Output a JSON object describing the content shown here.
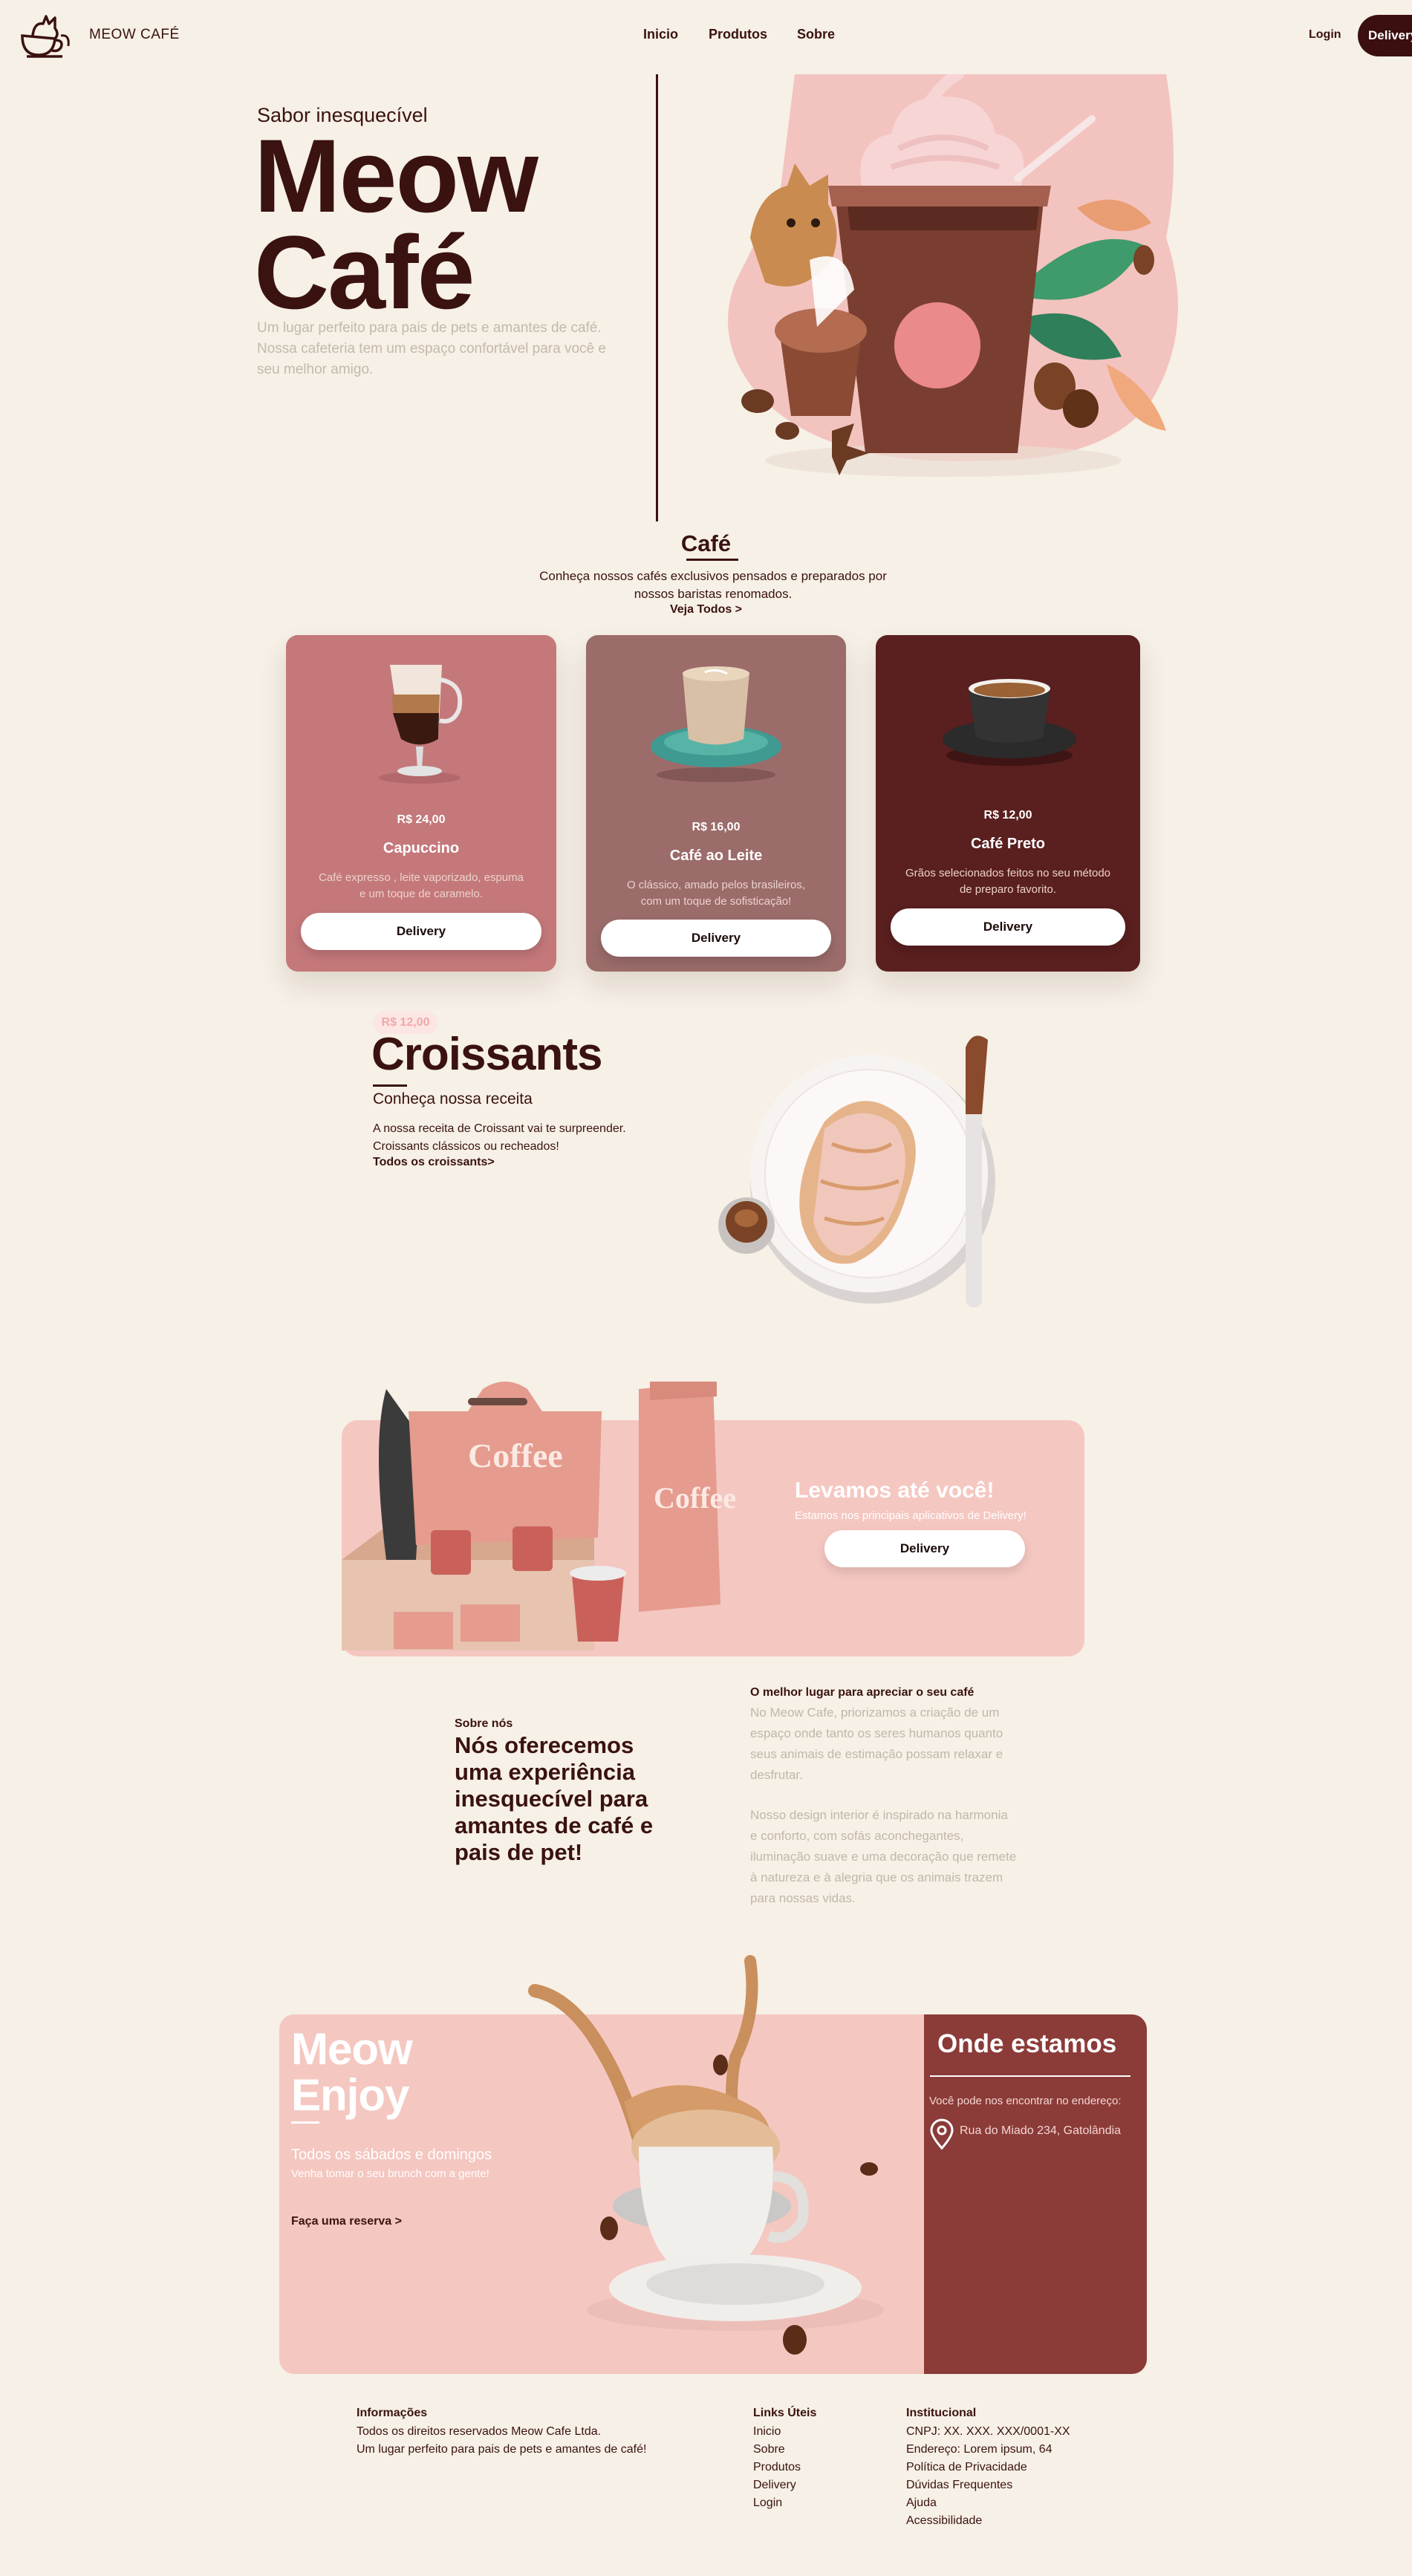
{
  "nav": {
    "brand": "MEOW CAFÉ",
    "links": [
      "Inicio",
      "Produtos",
      "Sobre"
    ],
    "login": "Login",
    "delivery": "Delivery"
  },
  "hero": {
    "kicker": "Sabor inesquecível",
    "title_line1": "Meow",
    "title_line2": "Café",
    "description": "Um lugar perfeito para pais de pets e amantes de café. Nossa cafeteria tem um espaço confortável para você e seu melhor amigo."
  },
  "cafe": {
    "title": "Café",
    "description": "Conheça nossos cafés exclusivos pensados e preparados por nossos baristas renomados.",
    "see_all": "Veja Todos >",
    "cards": [
      {
        "price": "R$ 24,00",
        "name": "Capuccino",
        "desc": "Café expresso , leite vaporizado, espuma e um toque de caramelo.",
        "button": "Delivery",
        "color": "#c4787a"
      },
      {
        "price": "R$ 16,00",
        "name": "Café ao Leite",
        "desc": "O clássico, amado pelos brasileiros, com um toque de sofisticação!",
        "button": "Delivery",
        "color": "#9b6c6a"
      },
      {
        "price": "R$ 12,00",
        "name": "Café Preto",
        "desc": "Grãos selecionados feitos no seu método de preparo favorito.",
        "button": "Delivery",
        "color": "#5a1f1f"
      }
    ]
  },
  "croissants": {
    "badge": "R$ 12,00",
    "title": "Croissants",
    "subtitle": "Conheça nossa receita",
    "description": "A nossa receita de Croissant vai te surpreender. Croissants clássicos ou recheados!",
    "link": "Todos os croissants>"
  },
  "delivery_banner": {
    "title": "Levamos até você!",
    "subtitle": "Estamos nos principais aplicativos de Delivery!",
    "button": "Delivery",
    "packaging_label": "Coffee"
  },
  "about": {
    "kicker": "Sobre nós",
    "title": "Nós oferecemos uma experiência inesquecível para amantes de café e pais de pet!",
    "right_heading": "O melhor lugar para apreciar o seu café",
    "paragraph1": "No Meow Cafe, priorizamos a criação de um espaço onde tanto os seres humanos quanto seus animais de estimação possam relaxar e desfrutar.",
    "paragraph2": "Nosso design interior é inspirado na harmonia e conforto, com sofás aconchegantes, iluminação suave e uma decoração que remete à natureza e à alegria que os animais trazem para nossas vidas."
  },
  "enjoy": {
    "title_line1": "Meow",
    "title_line2": "Enjoy",
    "line1": "Todos os sábados e domingos",
    "line2": "Venha tomar o seu brunch com a gente!",
    "link": "Faça uma reserva >",
    "where_title": "Onde estamos",
    "where_text": "Você pode nos encontrar no endereço:",
    "address": "Rua do Miado 234, Gatolândia"
  },
  "footer": {
    "info_title": "Informações",
    "info_lines": [
      "Todos os direitos reservados Meow Cafe Ltda.",
      "Um lugar perfeito para pais de pets e amantes de café!"
    ],
    "links_title": "Links Úteis",
    "links": [
      "Inicio",
      "Sobre",
      "Produtos",
      "Delivery",
      "Login"
    ],
    "inst_title": "Institucional",
    "inst_lines": [
      "CNPJ: XX. XXX. XXX/0001-XX",
      "Endereço: Lorem ipsum, 64",
      "Política de Privacidade",
      "Dúvidas Frequentes",
      "Ajuda",
      "Acessibilidade"
    ]
  },
  "colors": {
    "background": "#f6f0e6",
    "dark_brown": "#3a1210",
    "pink": "#f5c7c1",
    "maroon": "#8b3b38"
  }
}
